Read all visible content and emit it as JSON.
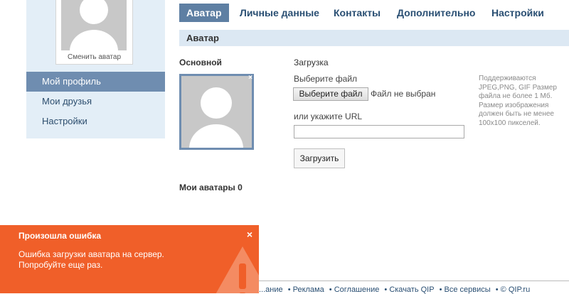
{
  "sidebar": {
    "change_avatar": "Сменить аватар",
    "items": [
      {
        "label": "Мой профиль"
      },
      {
        "label": "Мои друзья"
      },
      {
        "label": "Настройки"
      }
    ]
  },
  "tabs": [
    {
      "label": "Аватар"
    },
    {
      "label": "Личные данные"
    },
    {
      "label": "Контакты"
    },
    {
      "label": "Дополнительно"
    },
    {
      "label": "Настройки"
    }
  ],
  "section_title": "Аватар",
  "main": {
    "main_label": "Основной",
    "upload_label": "Загрузка",
    "choose_file_label": "Выберите файл",
    "choose_file_button": "Выберите файл",
    "no_file": "Файл не выбран",
    "url_label": "или укажите URL",
    "url_value": "",
    "upload_button": "Загрузить",
    "hint": "Поддерживаются JPEG,PNG, GIF Размер файла не более 1 Мб. Размер изображения должен быть не менее 100x100 пикселей.",
    "my_avatars": "Мои аватары 0"
  },
  "error": {
    "title": "Произошла ошибка",
    "message": "Ошибка загрузки аватара на сервер. Попробуйте еще раз.",
    "close": "×"
  },
  "footer": {
    "links": [
      "...ание",
      "• Реклама",
      "• Соглашение",
      "• Скачать QIP",
      "• Все сервисы",
      "• © QIP.ru"
    ]
  },
  "colors": {
    "accent": "#5e7fa3",
    "sidebar_bg": "#e3eef7",
    "error_bg": "#f05f29"
  }
}
